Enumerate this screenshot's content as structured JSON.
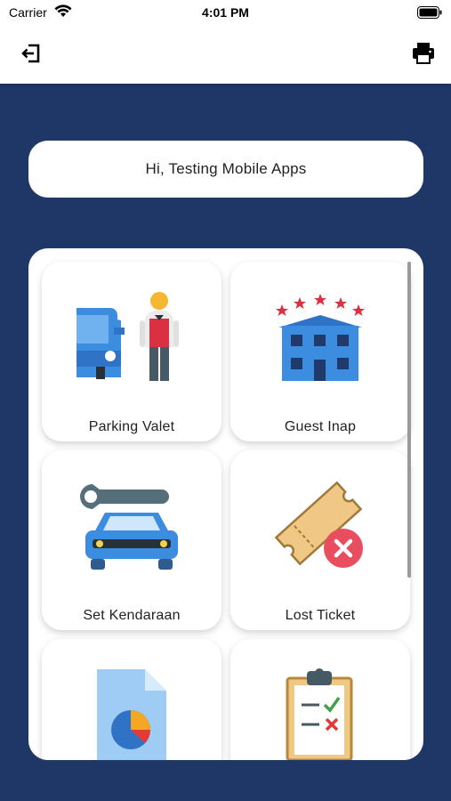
{
  "status_bar": {
    "carrier": "Carrier",
    "time": "4:01 PM"
  },
  "app_bar": {
    "logout_icon": "logout-icon",
    "print_icon": "printer-icon"
  },
  "greeting": "Hi, Testing Mobile Apps",
  "menu": [
    {
      "label": "Parking Valet",
      "icon": "valet-icon"
    },
    {
      "label": "Guest Inap",
      "icon": "hotel-icon"
    },
    {
      "label": "Set Kendaraan",
      "icon": "car-wrench-icon"
    },
    {
      "label": "Lost Ticket",
      "icon": "lost-ticket-icon"
    },
    {
      "label": "",
      "icon": "report-chart-icon"
    },
    {
      "label": "",
      "icon": "checklist-icon"
    }
  ],
  "colors": {
    "navy": "#1f3767",
    "blue": "#3c8de0",
    "red": "#d9313f"
  }
}
